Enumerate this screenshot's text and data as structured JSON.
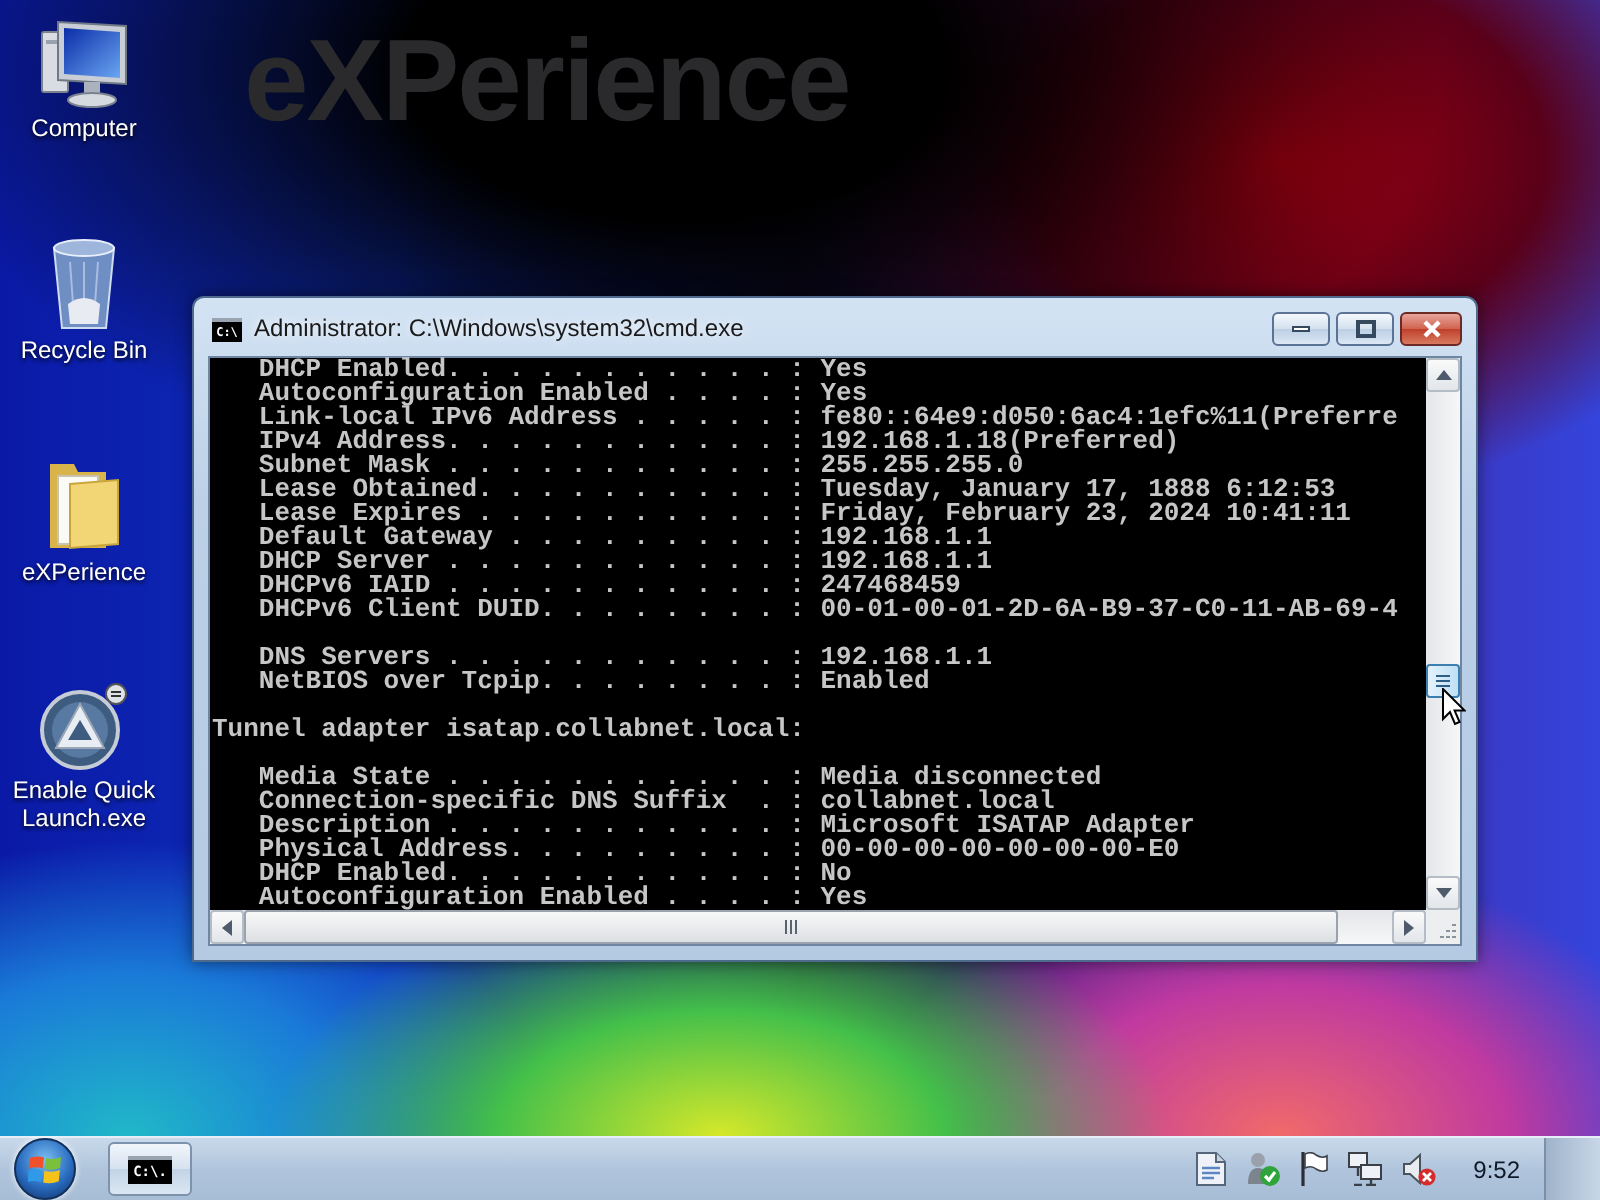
{
  "wallpaper": {
    "text": "eXPerience"
  },
  "desktop_icons": [
    {
      "kind": "computer",
      "label": "Computer"
    },
    {
      "kind": "recycle_bin",
      "label": "Recycle Bin"
    },
    {
      "kind": "folder",
      "label": "eXPerience"
    },
    {
      "kind": "program",
      "label": "Enable Quick Launch.exe"
    }
  ],
  "window": {
    "icon_text": "C:\\",
    "title": "Administrator: C:\\Windows\\system32\\cmd.exe",
    "controls": [
      {
        "kind": "minimize"
      },
      {
        "kind": "maximize"
      },
      {
        "kind": "close"
      }
    ],
    "console": {
      "sections": [
        {
          "entries": [
            "DHCP Enabled. . . . . . . . . . . : Yes",
            "Autoconfiguration Enabled . . . . : Yes",
            "Link-local IPv6 Address . . . . . : fe80::64e9:d050:6ac4:1efc%11(Preferre",
            "IPv4 Address. . . . . . . . . . . : 192.168.1.18(Preferred)",
            "Subnet Mask . . . . . . . . . . . : 255.255.255.0",
            "Lease Obtained. . . . . . . . . . : Tuesday, January 17, 1888 6:12:53",
            "Lease Expires . . . . . . . . . . : Friday, February 23, 2024 10:41:11",
            "Default Gateway . . . . . . . . . : 192.168.1.1",
            "DHCP Server . . . . . . . . . . . : 192.168.1.1",
            "DHCPv6 IAID . . . . . . . . . . . : 247468459",
            "DHCPv6 Client DUID. . . . . . . . : 00-01-00-01-2D-6A-B9-37-C0-11-AB-69-4"
          ]
        },
        {
          "entries": [
            "DNS Servers . . . . . . . . . . . : 192.168.1.1",
            "NetBIOS over Tcpip. . . . . . . . : Enabled"
          ]
        },
        {
          "heading": "Tunnel adapter isatap.collabnet.local:",
          "entries": [
            "Media State . . . . . . . . . . . : Media disconnected",
            "Connection-specific DNS Suffix  . : collabnet.local",
            "Description . . . . . . . . . . . : Microsoft ISATAP Adapter",
            "Physical Address. . . . . . . . . : 00-00-00-00-00-00-00-E0",
            "DHCP Enabled. . . . . . . . . . . : No",
            "Autoconfiguration Enabled . . . . : Yes"
          ]
        }
      ]
    }
  },
  "taskbar": {
    "programs": [
      {
        "kind": "console",
        "icon_text": "C:\\."
      }
    ],
    "tray": [
      {
        "kind": "document"
      },
      {
        "kind": "security"
      },
      {
        "kind": "flag"
      },
      {
        "kind": "network"
      },
      {
        "kind": "volume_muted"
      }
    ],
    "clock": "9:52"
  }
}
